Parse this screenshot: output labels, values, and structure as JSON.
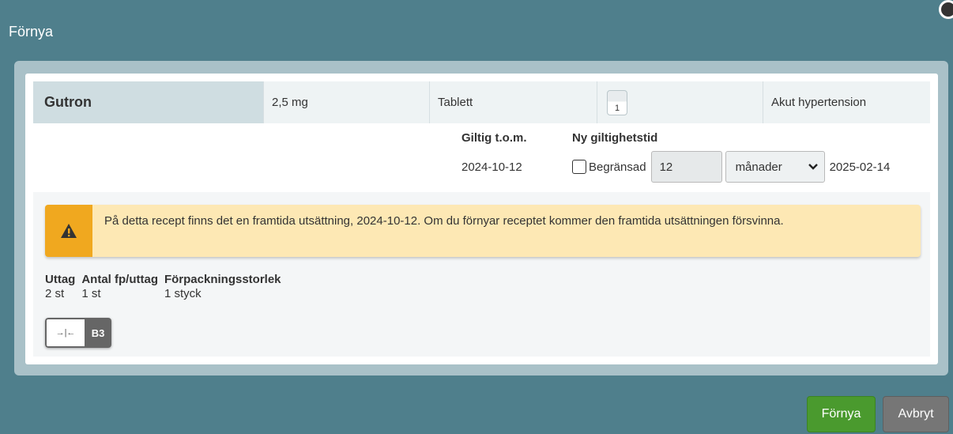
{
  "dialog": {
    "title": "Förnya",
    "close_icon": "close-icon"
  },
  "medication": {
    "name": "Gutron",
    "strength": "2,5 mg",
    "form": "Tablett",
    "quantity": "1",
    "indication": "Akut hypertension"
  },
  "validity": {
    "valid_label": "Giltig t.o.m.",
    "valid_value": "2024-10-12",
    "new_label": "Ny giltighetstid",
    "limited_label": "Begränsad",
    "limited_checked": false,
    "duration_value": "12",
    "unit_selected": "månader",
    "end_date": "2025-02-14"
  },
  "warning": {
    "icon": "warning-icon",
    "text": "På detta recept finns det en framtida utsättning, 2024-10-12. Om du förnyar receptet kommer den framtida utsättningen försvinna."
  },
  "dispensing": {
    "columns": [
      {
        "header": "Uttag",
        "value": "2 st"
      },
      {
        "header": "Antal fp/uttag",
        "value": "1 st"
      },
      {
        "header": "Förpackningsstorlek",
        "value": "1 styck"
      }
    ],
    "toggle_icon": "→|←",
    "toggle_label": "B3"
  },
  "buttons": {
    "renew": "Förnya",
    "cancel": "Avbryt"
  },
  "colors": {
    "background": "#4f7f8c",
    "warning_bg": "#fde8b4",
    "warning_accent": "#f0a81f",
    "renew_button": "#4a9a2e",
    "cancel_button": "#767676"
  }
}
